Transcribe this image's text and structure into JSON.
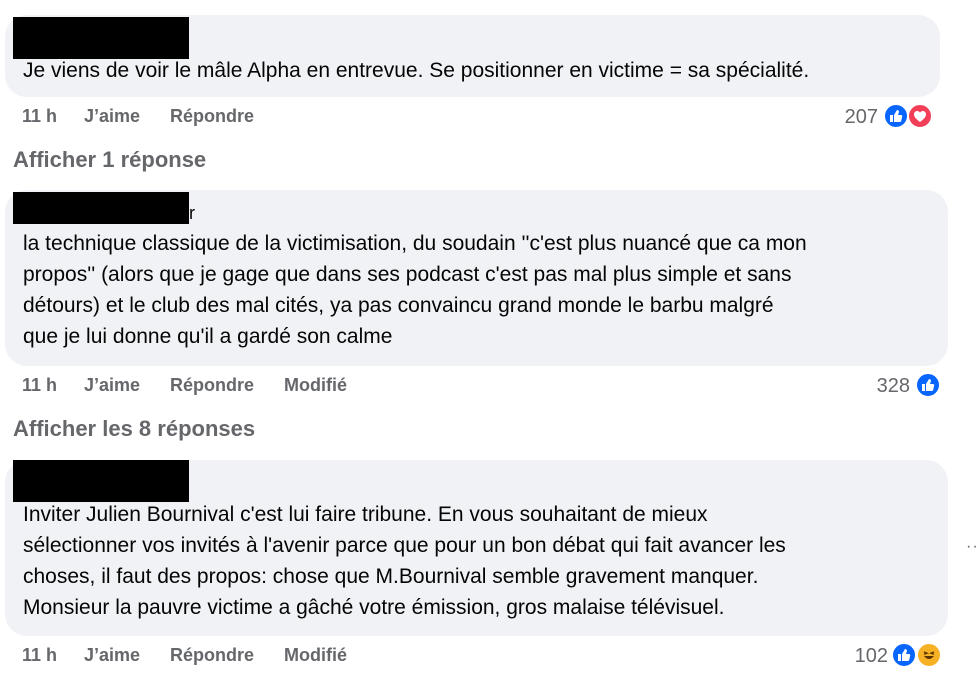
{
  "comments": [
    {
      "text": "Je viens de voir le mâle Alpha en entrevue. Se positionner en victime = sa spécialité.",
      "time": "11 h",
      "like": "J’aime",
      "reply": "Répondre",
      "edited": "",
      "reactions_count": "207",
      "reactions": [
        "like",
        "love"
      ]
    },
    {
      "text": "la technique classique de la victimisation, du soudain ''c'est plus nuancé que ca mon\npropos'' (alors que je gage que dans ses podcast c'est pas mal plus simple et sans\ndétours) et le club des mal cités, ya pas convaincu grand monde le barbu malgré\nque je lui donne qu'il a gardé son calme",
      "name_tail": "r",
      "time": "11 h",
      "like": "J’aime",
      "reply": "Répondre",
      "edited": "Modifié",
      "reactions_count": "328",
      "reactions": [
        "like"
      ]
    },
    {
      "text": "Inviter Julien Bournival c'est lui faire tribune. En vous souhaitant de mieux\nsélectionner vos invités à l'avenir parce que pour un bon débat qui fait avancer les\nchoses, il faut des propos: chose que M.Bournival semble gravement manquer.\nMonsieur la pauvre victime a gâché votre émission, gros malaise télévisuel.",
      "time": "11 h",
      "like": "J’aime",
      "reply": "Répondre",
      "edited": "Modifié",
      "reactions_count": "102",
      "reactions": [
        "like",
        "haha"
      ]
    }
  ],
  "show_replies": [
    "Afficher 1 réponse",
    "Afficher les 8 réponses"
  ],
  "colors": {
    "bubble": "#f0f2f5",
    "secondary_text": "#65676b",
    "like_blue": "#0866ff",
    "love_red": "#f33e58",
    "haha_yellow": "#f7b125"
  },
  "icons": [
    "like-icon",
    "love-icon",
    "haha-icon",
    "more-options-icon"
  ]
}
